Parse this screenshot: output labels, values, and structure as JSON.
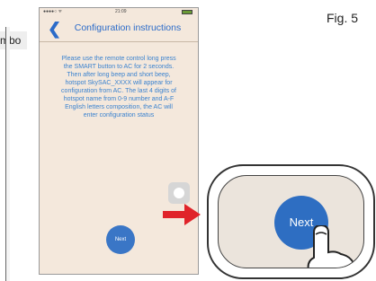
{
  "figure_label": "Fig. 5",
  "background_fragment": "mbo",
  "status_bar": {
    "carrier": "●●●●○ ᯤ",
    "time": "21:09"
  },
  "nav": {
    "back_icon": "chevron-left-icon",
    "title": "Configuration instructions"
  },
  "instructions": "Please use the remote control long press the SMART button to AC for 2 seconds. Then after long beep and short beep, hotspot SkySAC_XXXX will appear for configuration from AC. The last 4 digits of hotspot name from 0-9 number and A-F English letters composition, the AC will enter configuration status",
  "next_button_small": "Next",
  "next_button_large": "Next",
  "colors": {
    "accent": "#2b6bc9",
    "screen_bg": "#f4e8dc",
    "arrow": "#e0232a"
  }
}
